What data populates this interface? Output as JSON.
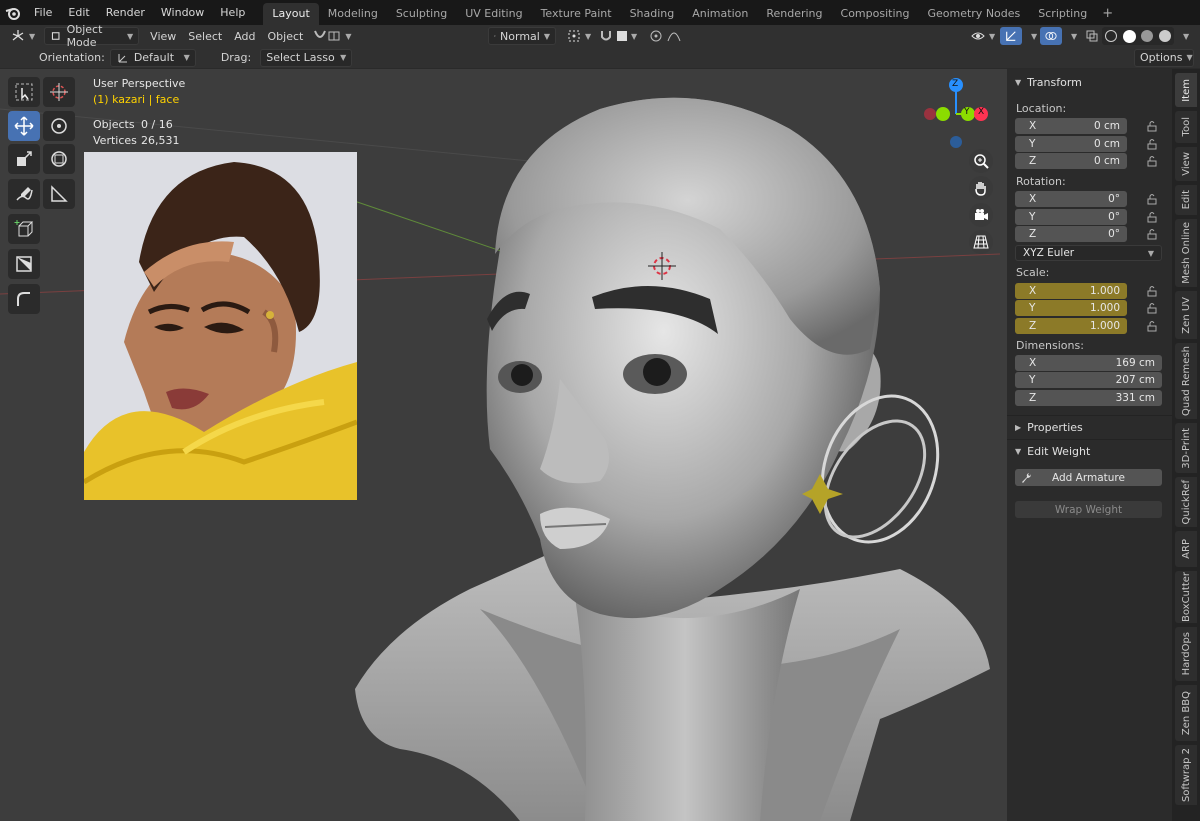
{
  "menu": [
    "File",
    "Edit",
    "Render",
    "Window",
    "Help"
  ],
  "workspaces": [
    {
      "label": "Layout",
      "active": true
    },
    {
      "label": "Modeling"
    },
    {
      "label": "Sculpting"
    },
    {
      "label": "UV Editing"
    },
    {
      "label": "Texture Paint"
    },
    {
      "label": "Shading"
    },
    {
      "label": "Animation"
    },
    {
      "label": "Rendering"
    },
    {
      "label": "Compositing"
    },
    {
      "label": "Geometry Nodes"
    },
    {
      "label": "Scripting"
    }
  ],
  "workspace_add": "+",
  "header": {
    "mode": "Object Mode",
    "view": "View",
    "select": "Select",
    "add": "Add",
    "object": "Object",
    "transform_orientation": "Normal",
    "orientation_label": "Orientation:",
    "orientation_value": "Default",
    "drag_label": "Drag:",
    "drag_value": "Select Lasso X-...",
    "options": "Options"
  },
  "overlay": {
    "view_name": "User Perspective",
    "object_context": "(1) kazari | face",
    "objects_label": "Objects",
    "objects_value": "0 / 16",
    "vertices_label": "Vertices",
    "vertices_value": "26,531"
  },
  "gizmo": {
    "z": "Z",
    "y": "Y",
    "x": "X"
  },
  "panel": {
    "transform_title": "Transform",
    "location_label": "Location:",
    "location": [
      {
        "axis": "X",
        "value": "0 cm"
      },
      {
        "axis": "Y",
        "value": "0 cm"
      },
      {
        "axis": "Z",
        "value": "0 cm"
      }
    ],
    "rotation_label": "Rotation:",
    "rotation": [
      {
        "axis": "X",
        "value": "0°"
      },
      {
        "axis": "Y",
        "value": "0°"
      },
      {
        "axis": "Z",
        "value": "0°"
      }
    ],
    "rotation_mode": "XYZ Euler",
    "scale_label": "Scale:",
    "scale": [
      {
        "axis": "X",
        "value": "1.000"
      },
      {
        "axis": "Y",
        "value": "1.000"
      },
      {
        "axis": "Z",
        "value": "1.000"
      }
    ],
    "dimensions_label": "Dimensions:",
    "dimensions": [
      {
        "axis": "X",
        "value": "169 cm"
      },
      {
        "axis": "Y",
        "value": "207 cm"
      },
      {
        "axis": "Z",
        "value": "331 cm"
      }
    ],
    "properties_title": "Properties",
    "edit_weight_title": "Edit Weight",
    "add_armature": "Add Armature",
    "wrap_weight": "Wrap Weight"
  },
  "side_tabs": [
    "Item",
    "Tool",
    "View",
    "Edit",
    "Mesh Online",
    "Zen UV",
    "Quad Remesh",
    "3D-Print",
    "QuickRef",
    "ARP",
    "BoxCutter",
    "HardOps",
    "Zen BBQ",
    "Softwrap 2"
  ],
  "colors": {
    "accent": "#4772b3",
    "active_object": "#ffd200",
    "scale_field": "#8c7a28",
    "gizmo_x": "#ff3352",
    "gizmo_y": "#8bdc00",
    "gizmo_z": "#2890ff"
  }
}
